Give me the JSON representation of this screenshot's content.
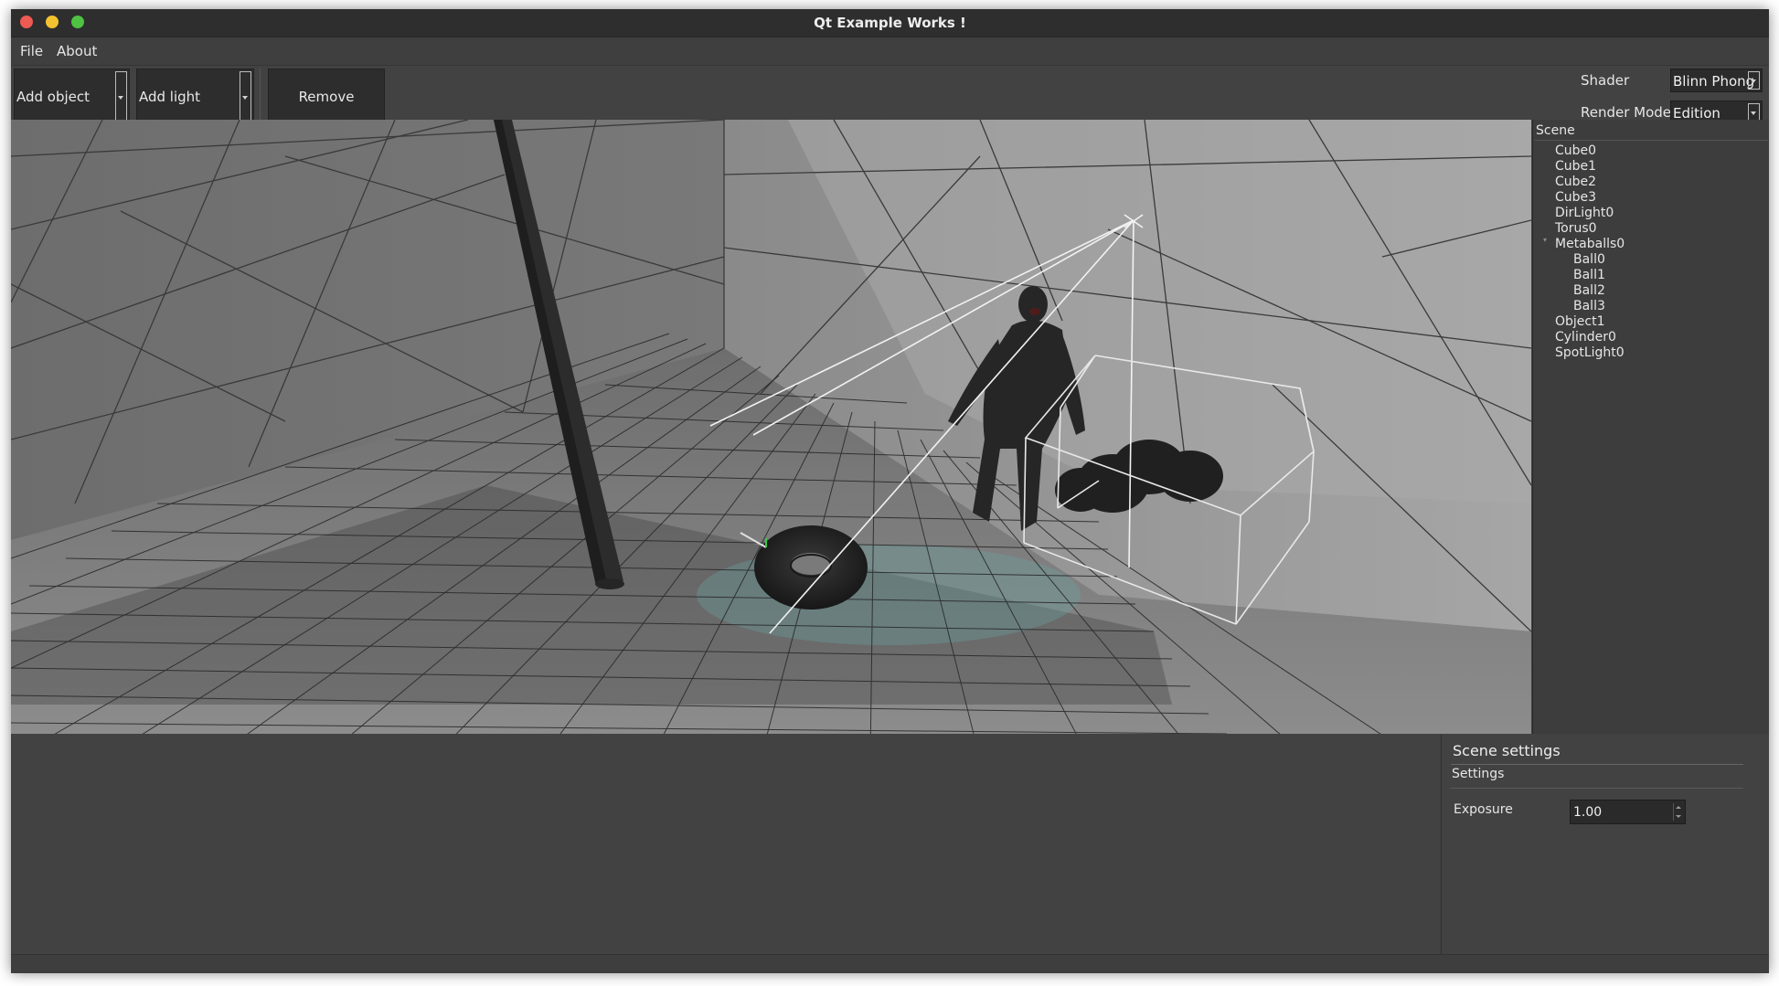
{
  "window": {
    "title": "Qt Example Works !"
  },
  "menu": {
    "items": [
      "File",
      "About"
    ]
  },
  "toolbar": {
    "add_object_label": "Add object",
    "add_light_label": "Add light",
    "remove_label": "Remove",
    "shader_label": "Shader",
    "shader_value": "Blinn Phong",
    "render_mode_label": "Render Mode",
    "render_mode_value": "Edition"
  },
  "scene": {
    "header": "Scene",
    "items": [
      {
        "label": "Cube0"
      },
      {
        "label": "Cube1"
      },
      {
        "label": "Cube2"
      },
      {
        "label": "Cube3"
      },
      {
        "label": "DirLight0"
      },
      {
        "label": "Torus0"
      },
      {
        "label": "Metaballs0",
        "expanded": true
      },
      {
        "label": "Ball0",
        "child": true
      },
      {
        "label": "Ball1",
        "child": true
      },
      {
        "label": "Ball2",
        "child": true
      },
      {
        "label": "Ball3",
        "child": true
      },
      {
        "label": "Object1"
      },
      {
        "label": "Cylinder0"
      },
      {
        "label": "SpotLight0"
      }
    ]
  },
  "settings": {
    "title": "Scene settings",
    "section": "Settings",
    "exposure_label": "Exposure",
    "exposure_value": "1.00"
  }
}
